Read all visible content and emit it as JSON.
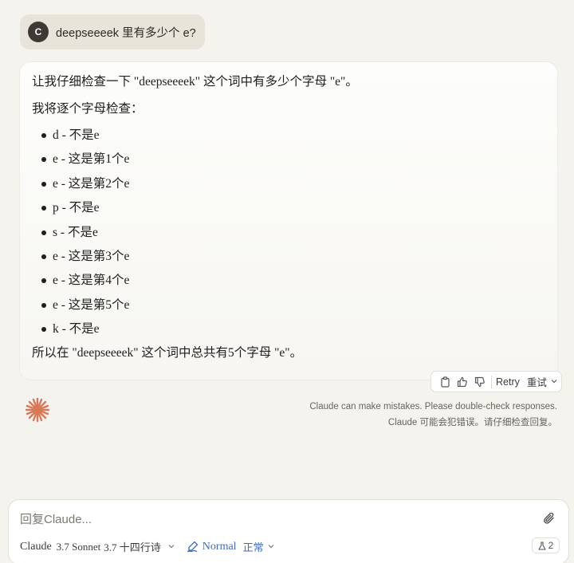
{
  "user_message": {
    "avatar_initial": "C",
    "text": "deepseeeek 里有多少个 e?"
  },
  "assistant_message": {
    "intro": "让我仔细检查一下 \"deepseeeek\" 这个词中有多少个字母 \"e\"。",
    "lead": "我将逐个字母检查：",
    "items": [
      "d - 不是e",
      "e - 这是第1个e",
      "e - 这是第2个e",
      "p - 不是e",
      "s - 不是e",
      "e - 这是第3个e",
      "e - 这是第4个e",
      "e - 这是第5个e",
      "k - 不是e"
    ],
    "conclusion": "所以在 \"deepseeeek\" 这个词中总共有5个字母 \"e\"。"
  },
  "actions": {
    "retry_label": "Retry",
    "retry_sub": "重试"
  },
  "disclaimer": {
    "line1": "Claude can make mistakes. Please double-check responses.",
    "line2": "Claude 可能会犯错误。请仔细检查回复。"
  },
  "composer": {
    "placeholder": "回复Claude...",
    "model_name": "Claude",
    "model_version": "3.7 Sonnet",
    "model_version_sub": "3.7 十四行诗",
    "style": "Normal",
    "style_sub": "正常",
    "badge_count": "2"
  },
  "colors": {
    "accent_spark": "#d97757",
    "style_blue": "#3c6ac0",
    "background": "#f4f3ee"
  }
}
